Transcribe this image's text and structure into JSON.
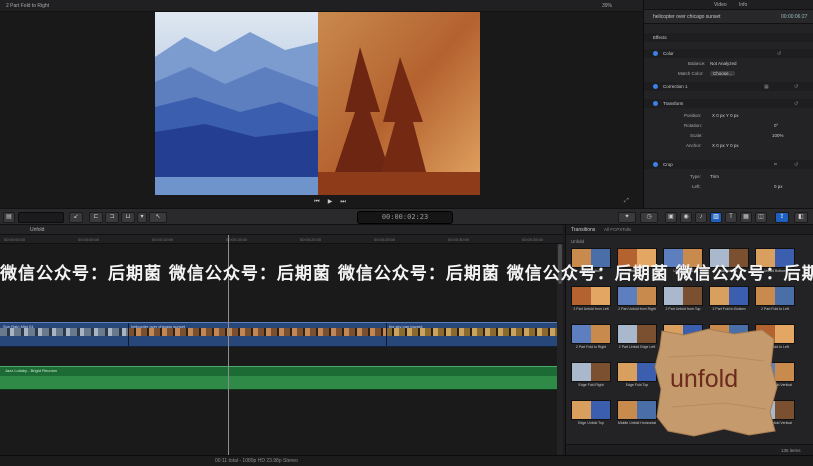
{
  "viewer": {
    "title": "2 Part Fold to Right",
    "zoom": "39%"
  },
  "inspector": {
    "tabs": [
      "Video",
      "Info"
    ],
    "clip_name": "helicopter over chicago sunset",
    "clip_timecode": "00:00:06:27",
    "rows": [
      {
        "label": "Effects",
        "value": ""
      },
      {
        "label": "Color",
        "value": ""
      },
      {
        "label": "Balance:",
        "value": "Not Analyzed"
      },
      {
        "label": "Match Color:",
        "value": "Choose..."
      },
      {
        "label": "Correction 1",
        "value": ""
      },
      {
        "label": "Transform",
        "value": ""
      },
      {
        "label": "Position:",
        "value": "X  0 px   Y  0 px"
      },
      {
        "label": "Rotation:",
        "value": "0°"
      },
      {
        "label": "Scale:",
        "value": "100%"
      },
      {
        "label": "Anchor:",
        "value": "X  0 px   Y  0 px"
      },
      {
        "label": "Crop",
        "value": ""
      },
      {
        "label": "Type:",
        "value": "Trim"
      },
      {
        "label": "Left:",
        "value": "0 px"
      }
    ]
  },
  "toolbar": {
    "timecode": "00:00:02:23"
  },
  "timeline": {
    "project": "Unfold",
    "ticks": [
      "00:00:00:00",
      "00:00:05:00",
      "00:00:10:00",
      "00:00:15:00",
      "00:00:20:00",
      "00:00:25:00",
      "00:00:30:00",
      "00:00:35:00"
    ],
    "clips": [
      "Sun Rain Mist 04",
      "helicopter over chicago sunset",
      "big sky pan toward"
    ],
    "audio_title": "Jazz Lullaby - Bright Reunion"
  },
  "watermark": "微信公众号：后期菌 微信公众号：后期菌 微信公众号：后期菌 微信公众号：后期菌 微信公众号：后期菌",
  "browser": {
    "title": "Transitions",
    "search": "All FCPXTolls",
    "section": "Unfold",
    "items": [
      "Unfold Bottom",
      "Unfold Left",
      "Unfold Right",
      "Unfold Top",
      "Unfold Bottom",
      "2 Part Unfold from Left",
      "2 Part Unfold from Right",
      "2 Part Unfold from Top",
      "2 Part Fold to Bottom",
      "2 Part Fold to Left",
      "2 Part Fold to Right",
      "2 Part Unfold Edge Left",
      "2 Part Unfold Edge Right",
      "2 Part Unfold Bottom",
      "2 Part Fold to Left",
      "Edge Fold Right",
      "Edge Fold Top",
      "Middle Unfold Left",
      "Middle Unfold Right",
      "Middle Unfold Vertical",
      "Edge Unfold Top",
      "Middle Unfold Horizontal",
      "Middle Unfold Vertical",
      "Middle Unfold Left",
      "Middle Unfold Vertical"
    ],
    "count": "135 items"
  },
  "sticker_text": "unfold",
  "status": "00:11 total - 1080p HD 23.98p Stereo",
  "colors": {
    "accent": "#1e5fbf",
    "video_clip": "#27467a",
    "audio_clip": "#1c6b34"
  }
}
